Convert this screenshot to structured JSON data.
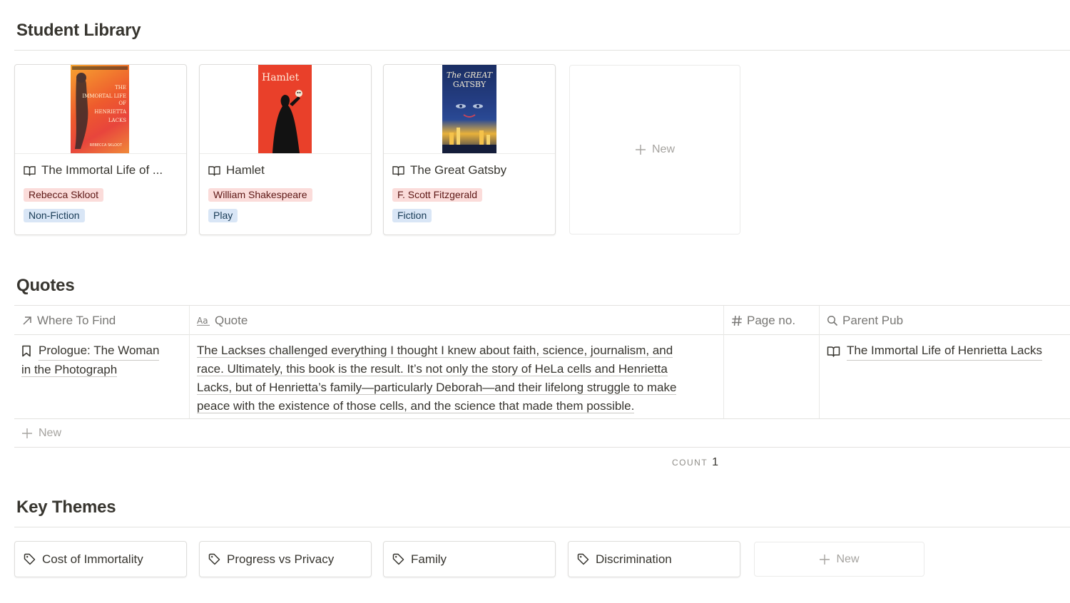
{
  "library": {
    "title": "Student Library",
    "new_label": "New",
    "books": [
      {
        "title": "The Immortal Life of ...",
        "author": "Rebecca Skloot",
        "genre": "Non-Fiction",
        "cover_text": "THE IMMORTAL LIFE OF HENRIETTA LACKS"
      },
      {
        "title": "Hamlet",
        "author": "William Shakespeare",
        "genre": "Play",
        "cover_text": "Hamlet"
      },
      {
        "title": "The Great Gatsby",
        "author": "F. Scott Fitzgerald",
        "genre": "Fiction",
        "cover_text": "The GREAT GATSBY"
      }
    ]
  },
  "quotes": {
    "title": "Quotes",
    "columns": [
      {
        "label": "Where To Find",
        "icon": "arrow-up-right-icon"
      },
      {
        "label": "Quote",
        "icon": "text-aa-icon"
      },
      {
        "label": "Page no.",
        "icon": "hash-icon"
      },
      {
        "label": "Parent Pub",
        "icon": "search-icon"
      }
    ],
    "rows": [
      {
        "where_line1": "Prologue: The Woman",
        "where_line2": "in the Photograph",
        "quote_lines": [
          "The Lackses challenged everything I thought I knew about faith, science, journalism, and",
          "race. Ultimately, this book is the result. It’s not only the story of HeLa cells and Henrietta",
          "Lacks, but of Henrietta’s family—particularly Deborah—and their lifelong struggle to make",
          "peace with the existence of those cells, and the science that made them possible."
        ],
        "page": "",
        "parent_pub": "The Immortal Life of Henrietta Lacks"
      }
    ],
    "new_label": "New",
    "count_label": "COUNT",
    "count_value": "1"
  },
  "themes": {
    "title": "Key Themes",
    "items": [
      "Cost of Immortality",
      "Progress vs Privacy",
      "Family",
      "Discrimination"
    ],
    "new_label": "New"
  },
  "colors": {
    "author_tag_bg": "#fbdcda",
    "genre_tag_bg": "#d9e6f6",
    "border": "#e3e2e0",
    "muted_text": "#787774"
  }
}
